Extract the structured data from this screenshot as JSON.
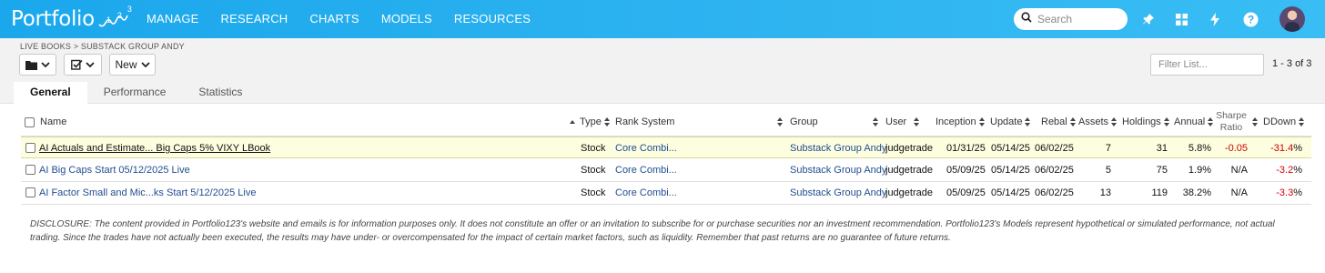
{
  "header": {
    "logo_text": "Portfolio",
    "logo_digits": [
      "1",
      "2",
      "3"
    ],
    "nav": [
      "MANAGE",
      "RESEARCH",
      "CHARTS",
      "MODELS",
      "RESOURCES"
    ],
    "search_placeholder": "Search",
    "icons": [
      "pin-icon",
      "grid-icon",
      "lightning-icon",
      "help-icon"
    ]
  },
  "toolbar": {
    "breadcrumb": "LIVE BOOKS > SUBSTACK GROUP ANDY",
    "new_label": "New",
    "filter_placeholder": "Filter List...",
    "page_count": "1 - 3 of 3"
  },
  "tabs": [
    {
      "label": "General",
      "active": true
    },
    {
      "label": "Performance",
      "active": false
    },
    {
      "label": "Statistics",
      "active": false
    }
  ],
  "table": {
    "headers": {
      "name": "Name",
      "type": "Type",
      "rank_system": "Rank System",
      "group": "Group",
      "user": "User",
      "inception": "Inception",
      "update": "Update",
      "rebal": "Rebal",
      "assets": "Assets",
      "holdings": "Holdings",
      "annual": "Annual",
      "sharpe_line1": "Sharpe",
      "sharpe_line2": "Ratio",
      "ddown": "DDown"
    },
    "rows": [
      {
        "name": "AI Actuals and Estimate... Big Caps 5% VIXY LBook",
        "type": "Stock",
        "rank_system": "Core Combi...",
        "group": "Substack Group Andy",
        "user": "judgetrade",
        "inception": "01/31/25",
        "update": "05/14/25",
        "rebal": "06/02/25",
        "assets": "7",
        "holdings": "31",
        "annual": "5.8%",
        "sharpe": "-0.05",
        "ddown": "-31.4",
        "ddown_pct": "%",
        "highlighted": true
      },
      {
        "name": "AI Big Caps Start 05/12/2025 Live",
        "type": "Stock",
        "rank_system": "Core Combi...",
        "group": "Substack Group Andy",
        "user": "judgetrade",
        "inception": "05/09/25",
        "update": "05/14/25",
        "rebal": "06/02/25",
        "assets": "5",
        "holdings": "75",
        "annual": "1.9%",
        "sharpe": "N/A",
        "ddown": "-3.2",
        "ddown_pct": "%",
        "highlighted": false
      },
      {
        "name": "AI Factor Small and Mic...ks Start 5/12/2025 Live",
        "type": "Stock",
        "rank_system": "Core Combi...",
        "group": "Substack Group Andy",
        "user": "judgetrade",
        "inception": "05/09/25",
        "update": "05/14/25",
        "rebal": "06/02/25",
        "assets": "13",
        "holdings": "119",
        "annual": "38.2%",
        "sharpe": "N/A",
        "ddown": "-3.3",
        "ddown_pct": "%",
        "highlighted": false
      }
    ]
  },
  "disclosure": "DISCLOSURE: The content provided in Portfolio123's website and emails is for information purposes only. It does not constitute an offer or an invitation to subscribe for or purchase securities nor an investment recommendation. Portfolio123's Models represent hypothetical or simulated performance, not actual trading. Since the trades have not actually been executed, the results may have under- or overcompensated for the impact of certain market factors, such as liquidity. Remember that past returns are no guarantee of future returns.",
  "colors": {
    "header_bg": "#1aa7ec",
    "link": "#1f4d8f",
    "negative": "#d00000",
    "highlight_row": "#fdfde0"
  }
}
